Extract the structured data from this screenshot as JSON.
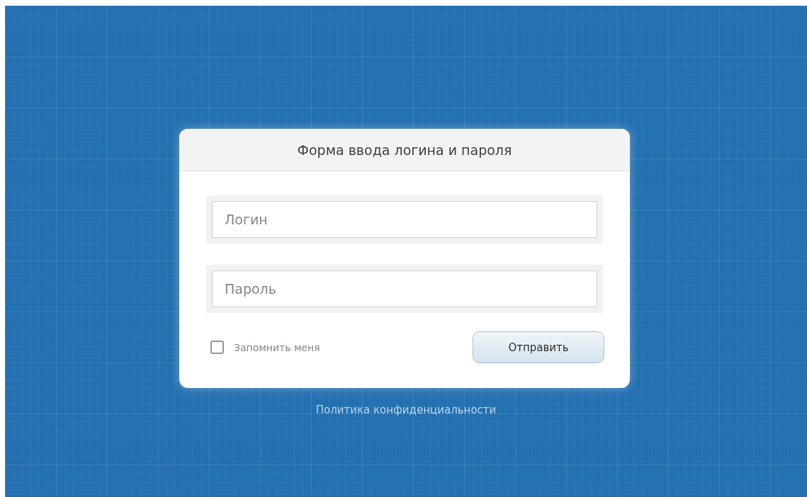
{
  "form": {
    "title": "Форма ввода логина и пароля",
    "fields": [
      {
        "placeholder": "Логин"
      },
      {
        "placeholder": "Пароль"
      }
    ],
    "remember": {
      "label": "Запомнить меня",
      "checked": false
    },
    "submit": "Отправить"
  },
  "footer_link": "Политика конфиденциальности"
}
